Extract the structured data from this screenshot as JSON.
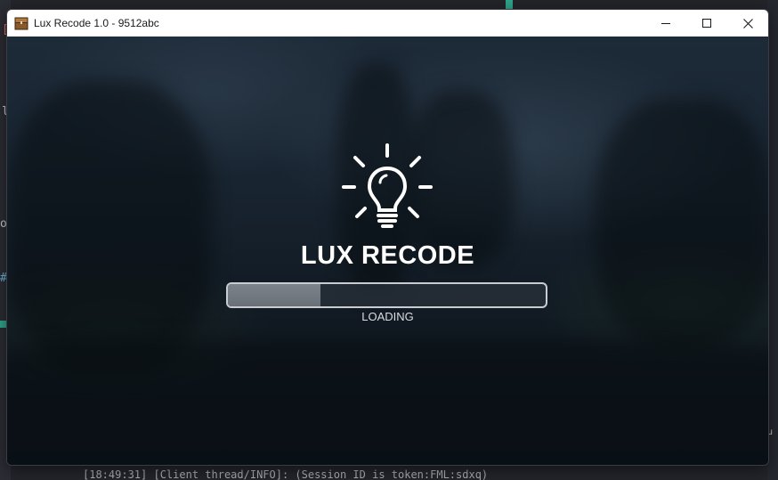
{
  "window": {
    "title": "Lux Recode 1.0 - 9512abc",
    "icon": "chest-block-icon"
  },
  "controls": {
    "minimize": "minimize-icon",
    "maximize": "maximize-icon",
    "close": "close-icon"
  },
  "splash": {
    "logo": "lightbulb-icon",
    "brand": "LUX RECODE",
    "loading_label": "LOADING",
    "progress": 0.29
  },
  "background": {
    "glyphs": [
      "[",
      "l",
      "o",
      "#",
      "u"
    ],
    "console_line": "[18:49:31] [Client thread/INFO]: (Session ID is token:FML:sdxq)"
  },
  "colors": {
    "accent_teal": "#2fa58c",
    "titlebar": "#ffffff",
    "text_light": "#ffffff"
  }
}
